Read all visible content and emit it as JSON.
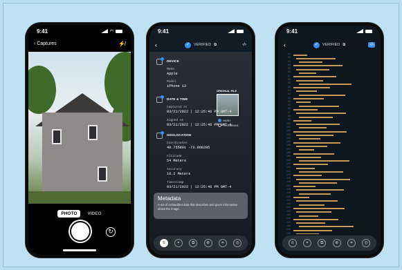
{
  "phone1": {
    "time": "9:41",
    "nav_back": "Captures",
    "mode_photo": "PHOTO",
    "mode_video": "VIDEO"
  },
  "phone2": {
    "time": "9:41",
    "header_status": "VERIFIED",
    "sections": {
      "device": "DEVICE",
      "make_key": "Make",
      "make_val": "Apple",
      "model_key": "Model",
      "model_val": "iPhone 13",
      "datetime": "DATE & TIME",
      "captured_key": "Captured At",
      "captured_val": "03/21/2022 | 12:25:46 PM GMT-4",
      "signed_key": "Signed At",
      "signed_val": "03/21/2022 | 12:25:46 PM GMT-4",
      "geo": "GEOLOCATION",
      "coord_key": "Coordinates",
      "coord_val": "40.755891 -73.968285",
      "alt_key": "Altitude",
      "alt_val": "54 Meters",
      "acc_key": "Accuracy",
      "acc_val": "16.2 Meters",
      "ts_key": "Timestamp",
      "ts_val": "03/21/2022 | 12:25:46 PM GMT-4"
    },
    "original_file": "ORIGINAL FILE",
    "radio_hash": "HASH",
    "radio_thumb": "THUMBNAIL",
    "tip_title": "Metadata",
    "tip_text": "A set of embedded data that describes and gives information about the image."
  },
  "phone3": {
    "time": "9:41",
    "header_status": "VERIFIED"
  },
  "toolbar_icons": [
    "metadata-icon",
    "map-icon",
    "copy-icon",
    "zoom-icon",
    "crop-icon",
    "focus-icon"
  ]
}
